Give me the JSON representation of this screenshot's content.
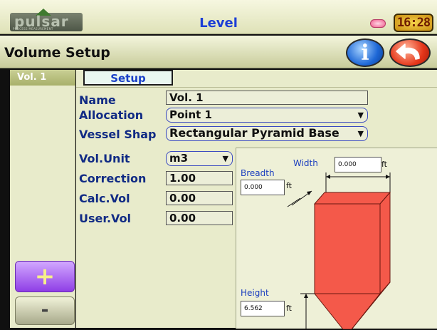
{
  "topbar": {
    "logo_text": "pulsar",
    "logo_subtext": "PROCESS MEASUREMENT",
    "title": "Level",
    "clock": "16:28",
    "colors": {
      "title": "#1c3ed6",
      "alarm": "#f05a8c",
      "clock_bg": "#e0b024"
    }
  },
  "header": {
    "title": "Volume Setup",
    "info_icon": "info-icon",
    "back_icon": "back-arrow-icon"
  },
  "left_panel": {
    "vessel_tab": "Vol. 1",
    "add_label": "+",
    "remove_label": "-"
  },
  "content": {
    "tab": "Setup",
    "fields": {
      "name": {
        "label": "Name",
        "value": "Vol.  1"
      },
      "allocation": {
        "label": "Allocation",
        "value": "Point 1"
      },
      "vessel_shape": {
        "label": "Vessel Shap",
        "value": "Rectangular Pyramid Base"
      },
      "vol_unit": {
        "label": "Vol.Unit",
        "value": "m3"
      },
      "correction": {
        "label": "Correction",
        "value": "1.00"
      },
      "calc_vol": {
        "label": "Calc.Vol",
        "value": "0.00"
      },
      "user_vol": {
        "label": "User.Vol",
        "value": "0.00"
      }
    },
    "diagram": {
      "width_label": "Width",
      "width_value": "0.000",
      "breadth_label": "Breadth",
      "breadth_value": "0.000",
      "height_label": "Height",
      "height_value": "6.562",
      "unit": "ft",
      "vessel_color": "#f4594a"
    }
  }
}
